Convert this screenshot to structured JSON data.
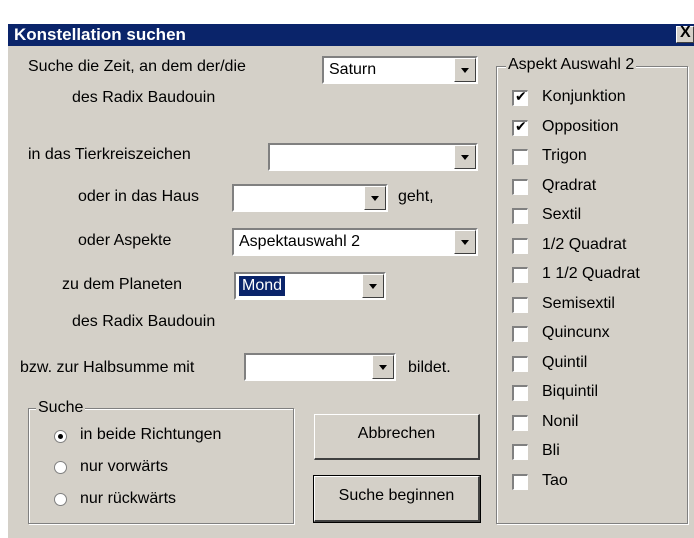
{
  "window": {
    "title": "Konstellation suchen",
    "close_label": "X"
  },
  "form": {
    "search_time_label": "Suche die Zeit, an dem der/die",
    "planet_value": "Saturn",
    "radix_label_1": "des Radix Baudouin",
    "zodiac_label": "in das Tierkreiszeichen",
    "zodiac_value": "",
    "house_label": "oder in das Haus",
    "house_value": "",
    "house_suffix": "geht,",
    "aspect_label": "oder Aspekte",
    "aspect_value": "Aspektauswahl 2",
    "target_planet_label": "zu dem Planeten",
    "target_planet_value": "Mond",
    "radix_label_2": "des Radix Baudouin",
    "halfsum_label": "bzw. zur Halbsumme mit",
    "halfsum_value": "",
    "halfsum_suffix": "bildet."
  },
  "search_group": {
    "title": "Suche",
    "options": [
      {
        "label": "in beide Richtungen",
        "selected": true
      },
      {
        "label": "nur vorwärts",
        "selected": false
      },
      {
        "label": "nur rückwärts",
        "selected": false
      }
    ]
  },
  "buttons": {
    "cancel": "Abbrechen",
    "start": "Suche beginnen"
  },
  "aspect_group": {
    "title": "Aspekt Auswahl 2",
    "items": [
      {
        "label": "Konjunktion",
        "checked": true
      },
      {
        "label": "Opposition",
        "checked": true
      },
      {
        "label": "Trigon",
        "checked": false
      },
      {
        "label": "Qradrat",
        "checked": false
      },
      {
        "label": "Sextil",
        "checked": false
      },
      {
        "label": "1/2 Quadrat",
        "checked": false
      },
      {
        "label": "1 1/2 Quadrat",
        "checked": false
      },
      {
        "label": "Semisextil",
        "checked": false
      },
      {
        "label": "Quincunx",
        "checked": false
      },
      {
        "label": "Quintil",
        "checked": false
      },
      {
        "label": "Biquintil",
        "checked": false
      },
      {
        "label": "Nonil",
        "checked": false
      },
      {
        "label": "Bli",
        "checked": false
      },
      {
        "label": "Tao",
        "checked": false
      }
    ]
  },
  "colors": {
    "titlebar": "#0a246a",
    "face": "#d4d0c8"
  }
}
